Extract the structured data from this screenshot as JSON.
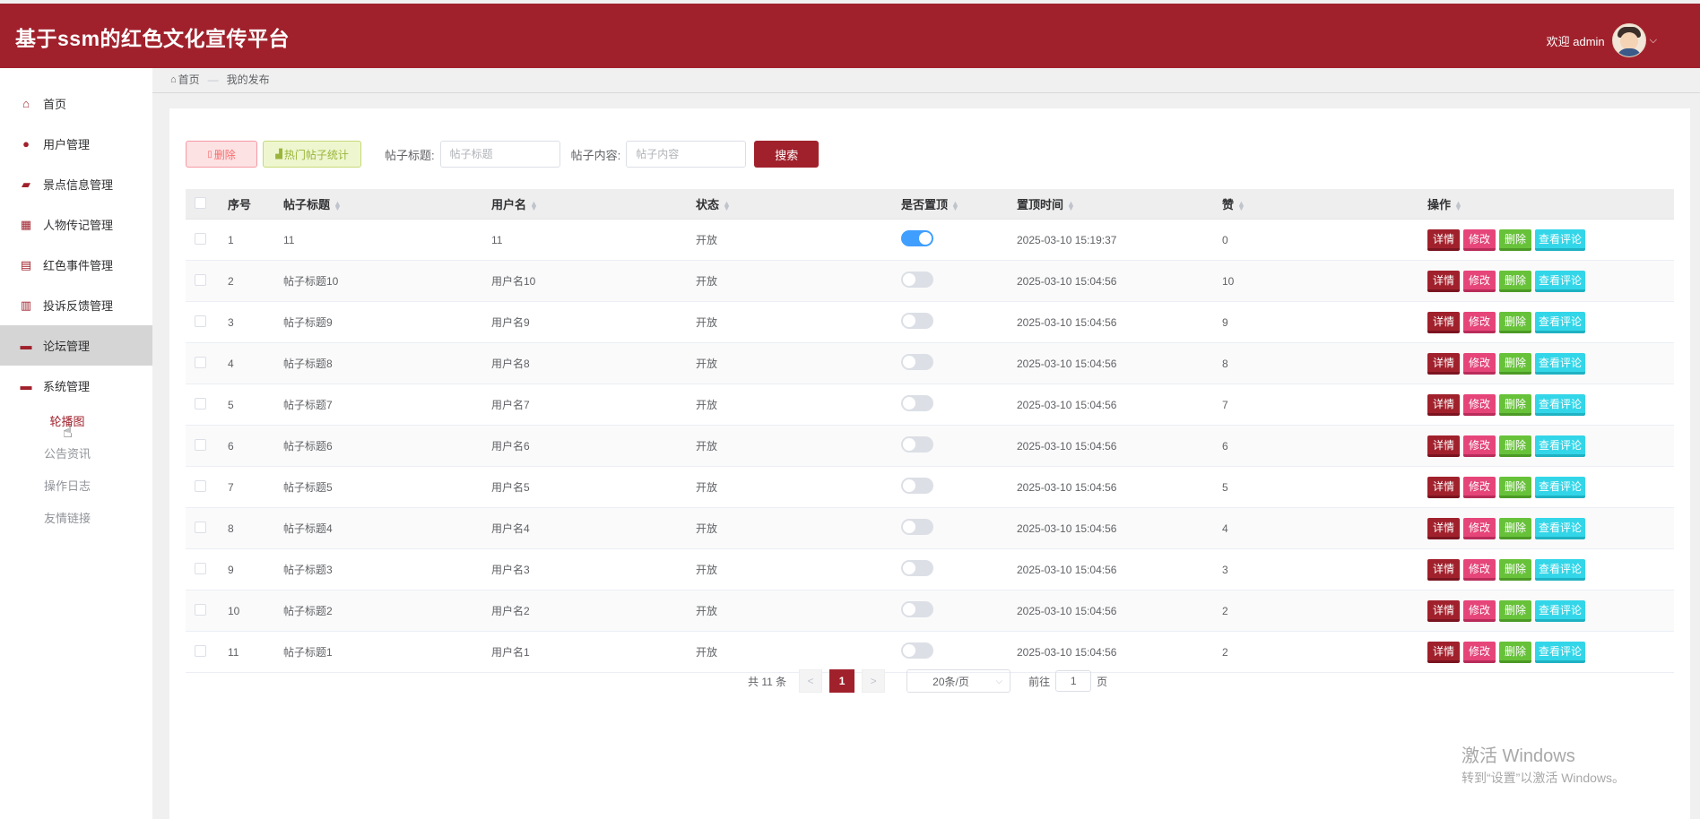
{
  "header": {
    "title": "基于ssm的红色文化宣传平台",
    "welcome": "欢迎 admin"
  },
  "sidebar": {
    "items": [
      {
        "label": "首页",
        "icon": "home-icon"
      },
      {
        "label": "用户管理",
        "icon": "user-icon"
      },
      {
        "label": "景点信息管理",
        "icon": "scenic-icon"
      },
      {
        "label": "人物传记管理",
        "icon": "grid-icon"
      },
      {
        "label": "红色事件管理",
        "icon": "table-icon"
      },
      {
        "label": "投诉反馈管理",
        "icon": "feedback-icon"
      },
      {
        "label": "论坛管理",
        "icon": "forum-icon"
      },
      {
        "label": "系统管理",
        "icon": "system-icon"
      }
    ],
    "subitems": [
      "轮播图",
      "公告资讯",
      "操作日志",
      "友情链接"
    ]
  },
  "breadcrumb": {
    "home": "首页",
    "sep": "—",
    "current": "我的发布"
  },
  "toolbar": {
    "delete_label": "删除",
    "hot_label": "热门帖子统计",
    "title_label": "帖子标题:",
    "title_placeholder": "帖子标题",
    "content_label": "帖子内容:",
    "content_placeholder": "帖子内容",
    "search_label": "搜索"
  },
  "table": {
    "headers": [
      "序号",
      "帖子标题",
      "用户名",
      "状态",
      "是否置顶",
      "置顶时间",
      "赞",
      "操作"
    ],
    "actions": [
      "详情",
      "修改",
      "删除",
      "查看评论"
    ],
    "rows": [
      {
        "no": "1",
        "title": "11",
        "user": "11",
        "status": "开放",
        "top": true,
        "time": "2025-03-10 15:19:37",
        "likes": "0"
      },
      {
        "no": "2",
        "title": "帖子标题10",
        "user": "用户名10",
        "status": "开放",
        "top": false,
        "time": "2025-03-10 15:04:56",
        "likes": "10"
      },
      {
        "no": "3",
        "title": "帖子标题9",
        "user": "用户名9",
        "status": "开放",
        "top": false,
        "time": "2025-03-10 15:04:56",
        "likes": "9"
      },
      {
        "no": "4",
        "title": "帖子标题8",
        "user": "用户名8",
        "status": "开放",
        "top": false,
        "time": "2025-03-10 15:04:56",
        "likes": "8"
      },
      {
        "no": "5",
        "title": "帖子标题7",
        "user": "用户名7",
        "status": "开放",
        "top": false,
        "time": "2025-03-10 15:04:56",
        "likes": "7"
      },
      {
        "no": "6",
        "title": "帖子标题6",
        "user": "用户名6",
        "status": "开放",
        "top": false,
        "time": "2025-03-10 15:04:56",
        "likes": "6"
      },
      {
        "no": "7",
        "title": "帖子标题5",
        "user": "用户名5",
        "status": "开放",
        "top": false,
        "time": "2025-03-10 15:04:56",
        "likes": "5"
      },
      {
        "no": "8",
        "title": "帖子标题4",
        "user": "用户名4",
        "status": "开放",
        "top": false,
        "time": "2025-03-10 15:04:56",
        "likes": "4"
      },
      {
        "no": "9",
        "title": "帖子标题3",
        "user": "用户名3",
        "status": "开放",
        "top": false,
        "time": "2025-03-10 15:04:56",
        "likes": "3"
      },
      {
        "no": "10",
        "title": "帖子标题2",
        "user": "用户名2",
        "status": "开放",
        "top": false,
        "time": "2025-03-10 15:04:56",
        "likes": "2"
      },
      {
        "no": "11",
        "title": "帖子标题1",
        "user": "用户名1",
        "status": "开放",
        "top": false,
        "time": "2025-03-10 15:04:56",
        "likes": "2"
      }
    ]
  },
  "pagination": {
    "total": "共 11 条",
    "prev": "<",
    "current": "1",
    "next": ">",
    "page_size": "20条/页",
    "goto": "前往",
    "goto_value": "1",
    "page": "页"
  },
  "watermark": {
    "line1": "激活 Windows",
    "line2": "转到“设置”以激活 Windows。"
  },
  "colors": {
    "brand": "#a0212c",
    "switch_on": "#409eff"
  }
}
